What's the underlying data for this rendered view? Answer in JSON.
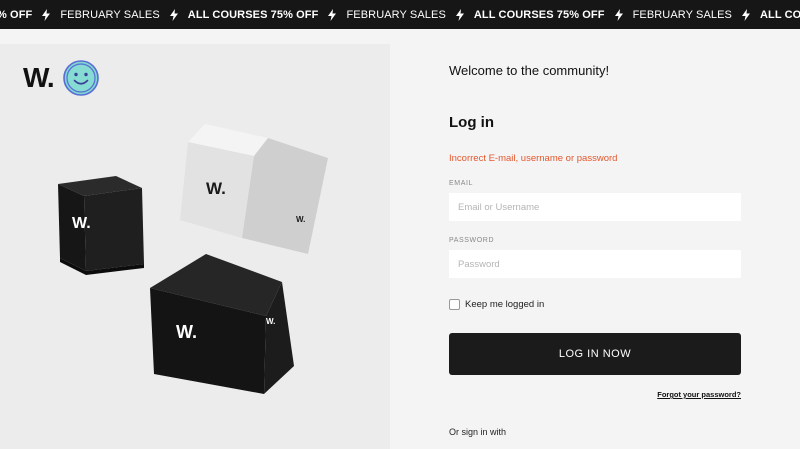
{
  "banner": {
    "items": [
      {
        "text": "% OFF",
        "bold": true
      },
      {
        "text": "FEBRUARY SALES",
        "bold": false
      },
      {
        "text": "ALL COURSES 75% OFF",
        "bold": true
      },
      {
        "text": "FEBRUARY SALES",
        "bold": false
      },
      {
        "text": "ALL COURSES 75% OFF",
        "bold": true
      },
      {
        "text": "FEBRUARY SALES",
        "bold": false
      },
      {
        "text": "ALL COURSES 75% OFF",
        "bold": true
      },
      {
        "text": "FEBRUARY SALES",
        "bold": false
      }
    ],
    "separator_icon": "lightning-bolt-icon"
  },
  "brand": {
    "logo_text": "W.",
    "logo_icon": "smiley-face-icon",
    "accent_color": "#6fd3c8"
  },
  "login": {
    "welcome": "Welcome to the community!",
    "title": "Log in",
    "error": "Incorrect E-mail, username or password",
    "error_color": "#e4572e",
    "email_label": "EMAIL",
    "email_placeholder": "Email or Username",
    "email_value": "",
    "password_label": "PASSWORD",
    "password_placeholder": "Password",
    "password_value": "",
    "remember_label": "Keep me logged in",
    "remember_checked": false,
    "button_label": "LOG IN NOW",
    "forgot_label": "Forgot your password?",
    "or_sign_in": "Or sign in with"
  }
}
